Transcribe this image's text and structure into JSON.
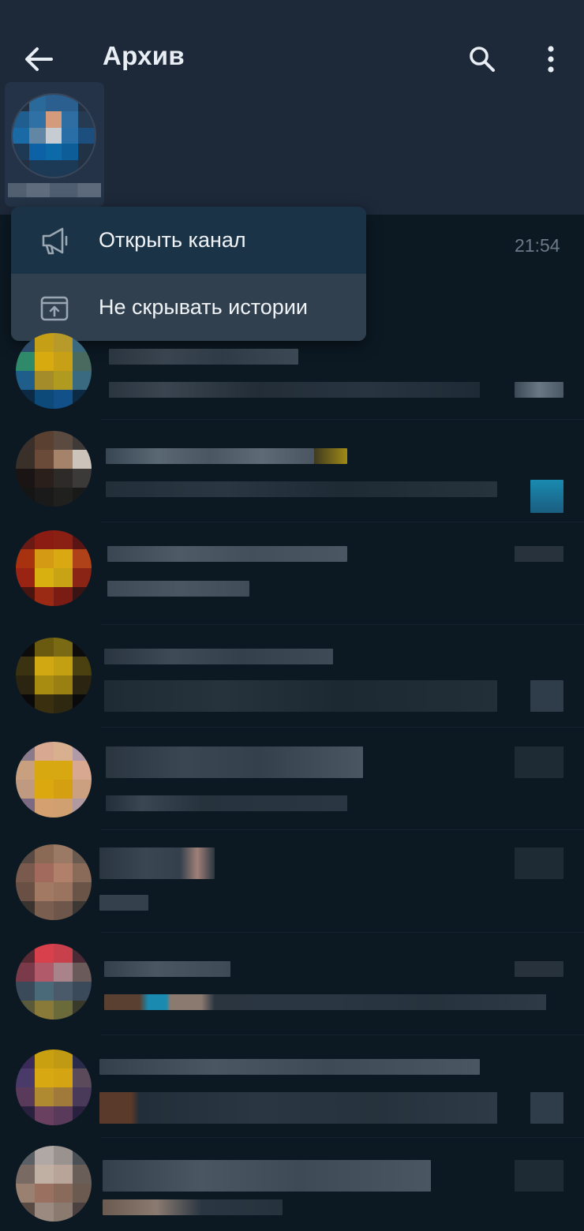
{
  "header": {
    "title": "Архив",
    "back_icon": "arrow-left-icon",
    "search_icon": "search-icon",
    "more_icon": "more-vertical-icon"
  },
  "context_menu": {
    "items": [
      {
        "label": "Открыть канал",
        "icon": "megaphone-icon"
      },
      {
        "label": "Не скрывать истории",
        "icon": "unarchive-icon"
      }
    ]
  },
  "first_chat": {
    "time": "21:54"
  },
  "colors": {
    "header_bg": "#1d2839",
    "list_bg": "#0c1923",
    "menu_bg": "#1b3346",
    "menu_active_bg": "#30404f",
    "text_primary": "#e9eef4",
    "text_muted": "#6b7a89"
  }
}
